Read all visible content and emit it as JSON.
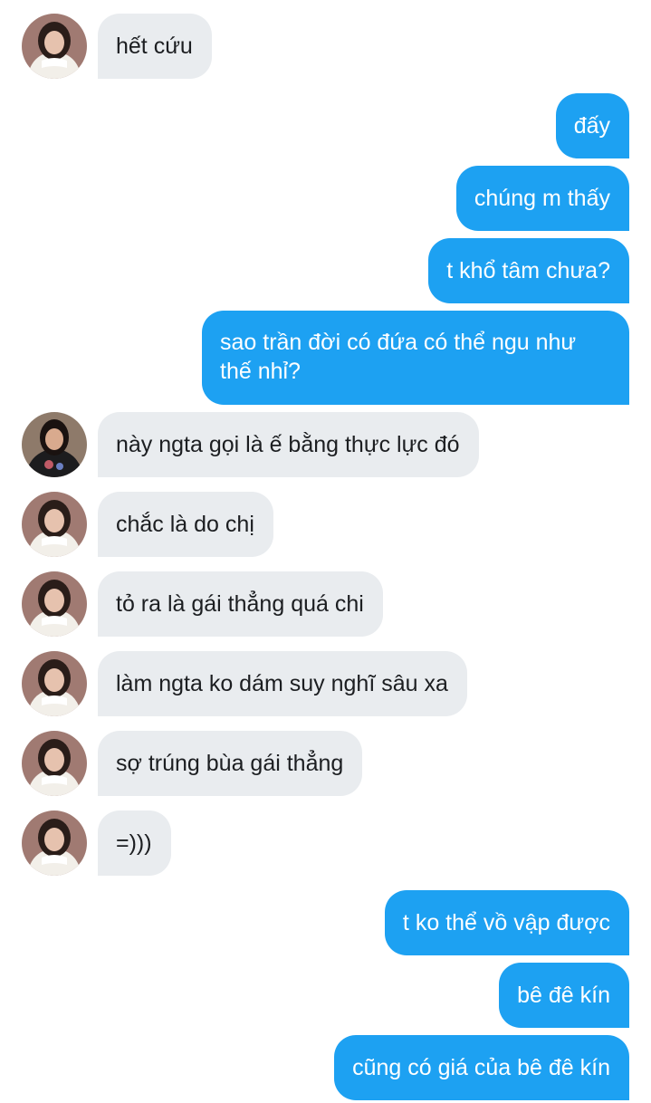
{
  "conversation": {
    "messages": [
      {
        "side": "in",
        "avatar": "avatar-a",
        "text": "hết cứu"
      },
      {
        "side": "out",
        "text": "đấy"
      },
      {
        "side": "out",
        "text": "chúng m thấy"
      },
      {
        "side": "out",
        "text": "t khổ tâm chưa?"
      },
      {
        "side": "out",
        "text": "sao trần đời có đứa có thể ngu như thế nhỉ?"
      },
      {
        "side": "in",
        "avatar": "avatar-b",
        "text": "này ngta gọi là ế bằng thực lực đó"
      },
      {
        "side": "in",
        "avatar": "avatar-a",
        "text": "chắc là do chị"
      },
      {
        "side": "in",
        "avatar": "avatar-a",
        "text": "tỏ ra là gái thẳng quá chi"
      },
      {
        "side": "in",
        "avatar": "avatar-a",
        "text": "làm ngta ko dám suy nghĩ sâu xa"
      },
      {
        "side": "in",
        "avatar": "avatar-a",
        "text": "sợ trúng bùa gái thẳng"
      },
      {
        "side": "in",
        "avatar": "avatar-a",
        "text": "=)))"
      },
      {
        "side": "out",
        "text": "t ko thể vồ vập được"
      },
      {
        "side": "out",
        "text": "bê đê kín"
      },
      {
        "side": "out",
        "text": "cũng có giá của bê đê kín"
      }
    ]
  },
  "colors": {
    "incoming_bubble": "#e9ecef",
    "outgoing_bubble": "#1da1f2",
    "incoming_text": "#1c1e21",
    "outgoing_text": "#ffffff"
  }
}
